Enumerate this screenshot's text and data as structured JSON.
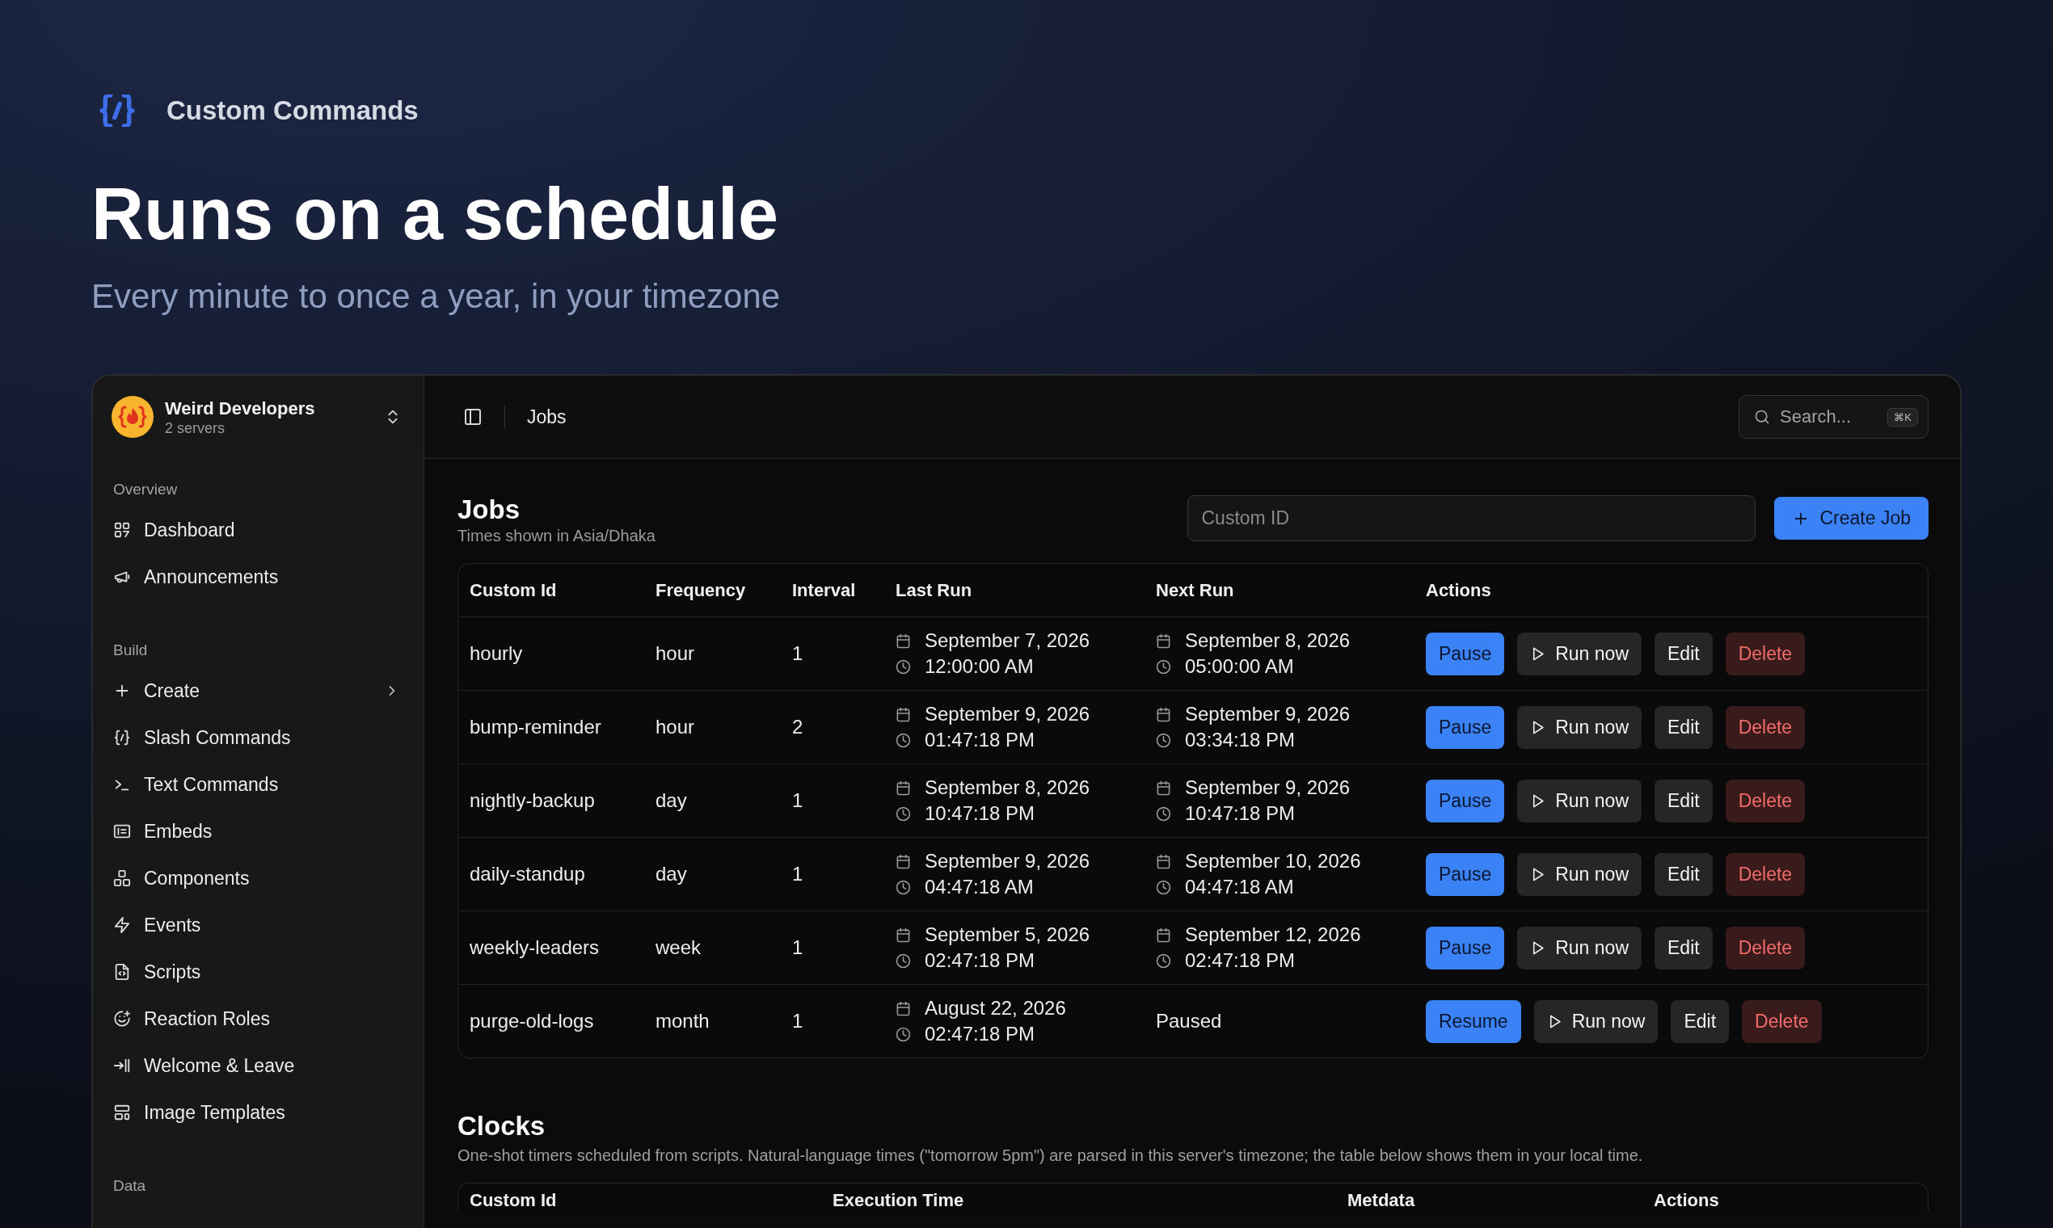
{
  "brand": {
    "name": "Custom Commands"
  },
  "hero": {
    "title": "Runs on a schedule",
    "subtitle": "Every minute to once a year, in your timezone"
  },
  "sidebar": {
    "workspace": {
      "name": "Weird Developers",
      "subtitle": "2 servers"
    },
    "sections": [
      {
        "label": "Overview",
        "items": [
          {
            "label": "Dashboard",
            "kind": "link"
          },
          {
            "label": "Announcements",
            "kind": "link"
          }
        ]
      },
      {
        "label": "Build",
        "items": [
          {
            "label": "Create",
            "kind": "submenu"
          },
          {
            "label": "Slash Commands",
            "kind": "link"
          },
          {
            "label": "Text Commands",
            "kind": "link"
          },
          {
            "label": "Embeds",
            "kind": "link"
          },
          {
            "label": "Components",
            "kind": "link"
          },
          {
            "label": "Events",
            "kind": "link"
          },
          {
            "label": "Scripts",
            "kind": "link"
          },
          {
            "label": "Reaction Roles",
            "kind": "link"
          },
          {
            "label": "Welcome & Leave",
            "kind": "link"
          },
          {
            "label": "Image Templates",
            "kind": "link"
          }
        ]
      },
      {
        "label": "Data"
      }
    ]
  },
  "topbar": {
    "breadcrumb": "Jobs",
    "search": {
      "label": "Search...",
      "shortcut": "⌘K"
    }
  },
  "jobs": {
    "title": "Jobs",
    "note": "Times shown in Asia/Dhaka",
    "custom_id": {
      "placeholder": "Custom ID"
    },
    "create_button": "Create Job",
    "table": {
      "columns": [
        "Custom Id",
        "Frequency",
        "Interval",
        "Last Run",
        "Next Run",
        "Actions"
      ],
      "rows": [
        {
          "custom_id": "hourly",
          "frequency": "hour",
          "interval": "1",
          "last_run": {
            "kind": "datetime",
            "date": "September 7, 2026",
            "time": "12:00:00 AM"
          },
          "next_run": {
            "kind": "datetime",
            "date": "September 8, 2026",
            "time": "05:00:00 AM"
          },
          "actions": [
            {
              "kind": "pause",
              "label": "Pause"
            },
            {
              "kind": "run",
              "label": "Run now"
            },
            {
              "kind": "edit",
              "label": "Edit"
            },
            {
              "kind": "delete",
              "label": "Delete"
            }
          ]
        },
        {
          "custom_id": "bump-reminder",
          "frequency": "hour",
          "interval": "2",
          "last_run": {
            "kind": "datetime",
            "date": "September 9, 2026",
            "time": "01:47:18 PM"
          },
          "next_run": {
            "kind": "datetime",
            "date": "September 9, 2026",
            "time": "03:34:18 PM"
          },
          "actions": [
            {
              "kind": "pause",
              "label": "Pause"
            },
            {
              "kind": "run",
              "label": "Run now"
            },
            {
              "kind": "edit",
              "label": "Edit"
            },
            {
              "kind": "delete",
              "label": "Delete"
            }
          ]
        },
        {
          "custom_id": "nightly-backup",
          "frequency": "day",
          "interval": "1",
          "last_run": {
            "kind": "datetime",
            "date": "September 8, 2026",
            "time": "10:47:18 PM"
          },
          "next_run": {
            "kind": "datetime",
            "date": "September 9, 2026",
            "time": "10:47:18 PM"
          },
          "actions": [
            {
              "kind": "pause",
              "label": "Pause"
            },
            {
              "kind": "run",
              "label": "Run now"
            },
            {
              "kind": "edit",
              "label": "Edit"
            },
            {
              "kind": "delete",
              "label": "Delete"
            }
          ]
        },
        {
          "custom_id": "daily-standup",
          "frequency": "day",
          "interval": "1",
          "last_run": {
            "kind": "datetime",
            "date": "September 9, 2026",
            "time": "04:47:18 AM"
          },
          "next_run": {
            "kind": "datetime",
            "date": "September 10, 2026",
            "time": "04:47:18 AM"
          },
          "actions": [
            {
              "kind": "pause",
              "label": "Pause"
            },
            {
              "kind": "run",
              "label": "Run now"
            },
            {
              "kind": "edit",
              "label": "Edit"
            },
            {
              "kind": "delete",
              "label": "Delete"
            }
          ]
        },
        {
          "custom_id": "weekly-leaders",
          "frequency": "week",
          "interval": "1",
          "last_run": {
            "kind": "datetime",
            "date": "September 5, 2026",
            "time": "02:47:18 PM"
          },
          "next_run": {
            "kind": "datetime",
            "date": "September 12, 2026",
            "time": "02:47:18 PM"
          },
          "actions": [
            {
              "kind": "pause",
              "label": "Pause"
            },
            {
              "kind": "run",
              "label": "Run now"
            },
            {
              "kind": "edit",
              "label": "Edit"
            },
            {
              "kind": "delete",
              "label": "Delete"
            }
          ]
        },
        {
          "custom_id": "purge-old-logs",
          "frequency": "month",
          "interval": "1",
          "last_run": {
            "kind": "datetime",
            "date": "August 22, 2026",
            "time": "02:47:18 PM"
          },
          "next_run": {
            "kind": "text",
            "text": "Paused"
          },
          "actions": [
            {
              "kind": "resume",
              "label": "Resume"
            },
            {
              "kind": "run",
              "label": "Run now"
            },
            {
              "kind": "edit",
              "label": "Edit"
            },
            {
              "kind": "delete",
              "label": "Delete"
            }
          ]
        }
      ]
    }
  },
  "clocks": {
    "title": "Clocks",
    "description": "One-shot timers scheduled from scripts. Natural-language times (\"tomorrow 5pm\") are parsed in this server's timezone; the table below shows them in your local time.",
    "table": {
      "columns": [
        "Custom Id",
        "Execution Time",
        "Metdata",
        "Actions"
      ]
    }
  }
}
